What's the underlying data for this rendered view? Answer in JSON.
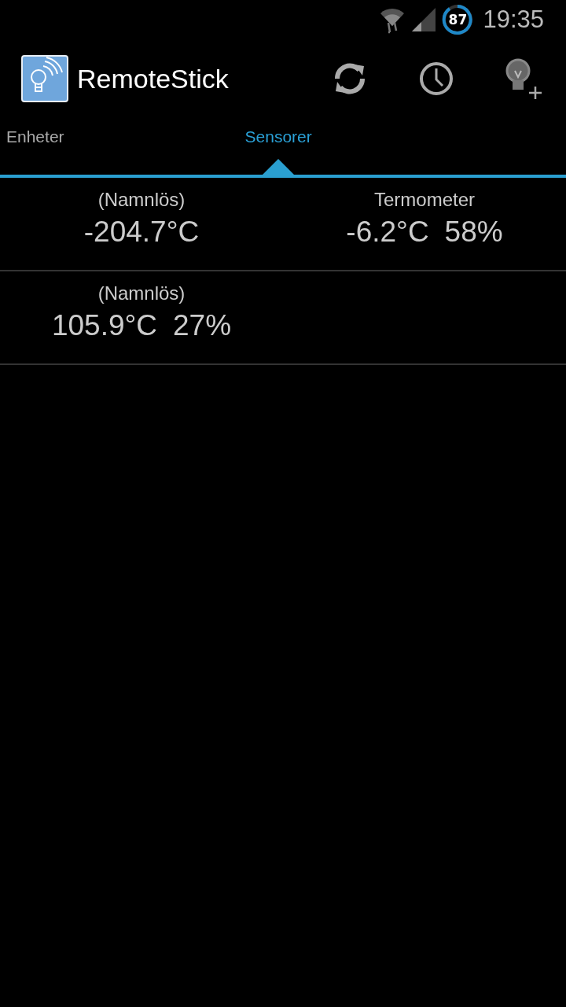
{
  "status_bar": {
    "battery": "87",
    "time": "19:35"
  },
  "action_bar": {
    "title": "RemoteStick"
  },
  "tabs": [
    {
      "label": "Enheter",
      "selected": false
    },
    {
      "label": "Sensorer",
      "selected": true
    }
  ],
  "sensor_rows": [
    [
      {
        "name": "(Namnlös)",
        "values": [
          "-204.7°C"
        ]
      },
      {
        "name": "Termometer",
        "values": [
          "-6.2°C",
          "58%"
        ]
      }
    ],
    [
      {
        "name": "(Namnlös)",
        "values": [
          "105.9°C",
          "27%"
        ]
      }
    ]
  ]
}
